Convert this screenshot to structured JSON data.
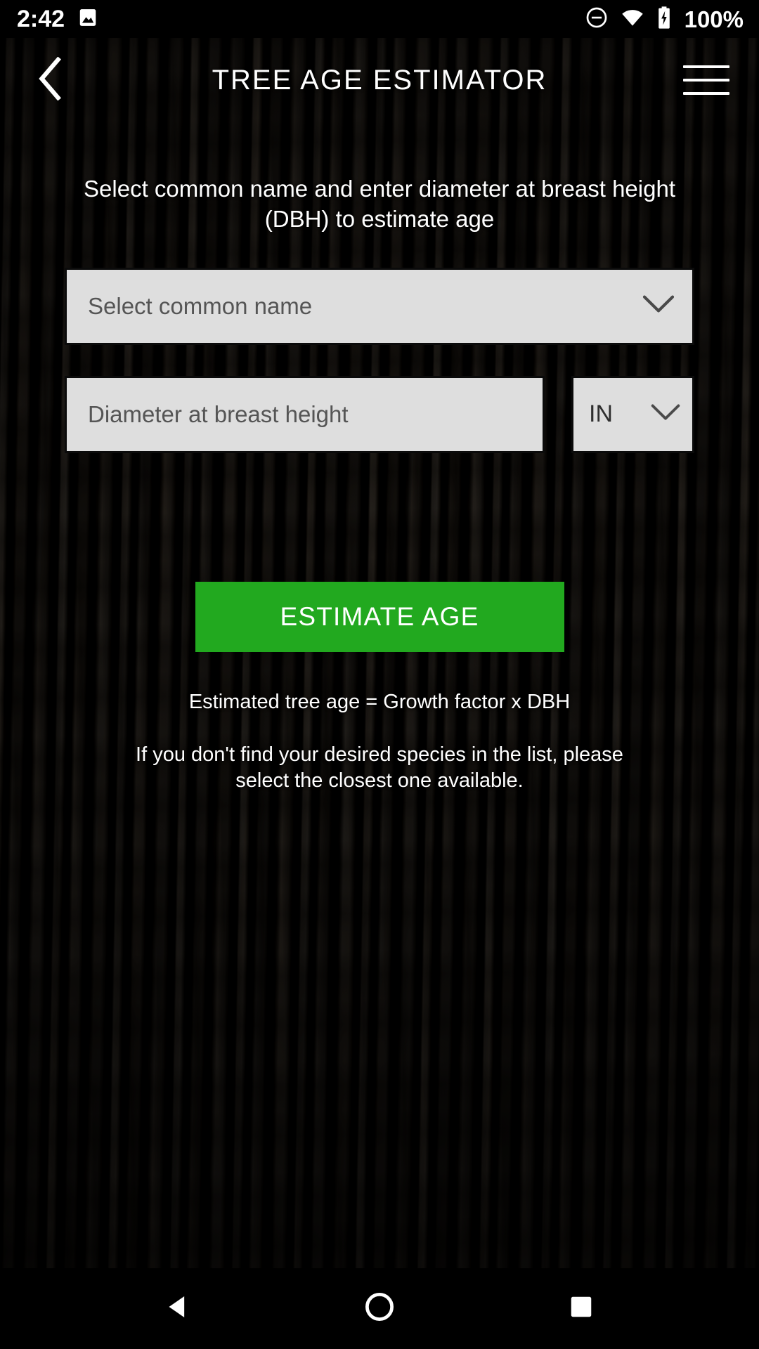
{
  "status_bar": {
    "time": "2:42",
    "battery_percent": "100%",
    "icons": {
      "notification": "image-icon",
      "dnd": "do-not-disturb-icon",
      "wifi": "wifi-icon",
      "battery": "battery-charging-icon"
    }
  },
  "app_bar": {
    "title": "TREE  AGE  ESTIMATOR",
    "back_icon": "chevron-left-icon",
    "menu_icon": "hamburger-menu-icon"
  },
  "main": {
    "instructions": "Select common name and enter diameter at breast height (DBH) to estimate age",
    "species_select": {
      "placeholder": "Select common name",
      "value": "",
      "chevron_icon": "chevron-down-icon"
    },
    "dbh_input": {
      "placeholder": "Diameter at breast height",
      "value": ""
    },
    "unit_select": {
      "value": "IN",
      "chevron_icon": "chevron-down-icon"
    },
    "estimate_button": {
      "label": "ESTIMATE AGE",
      "color": "#22a91f"
    },
    "formula_note": "Estimated tree age = Growth factor x DBH",
    "hint_note": "If you don't find your desired species in the list, please select the closest one available."
  },
  "nav_bar": {
    "back": "back-triangle-icon",
    "home": "home-circle-icon",
    "recents": "recents-square-icon"
  }
}
